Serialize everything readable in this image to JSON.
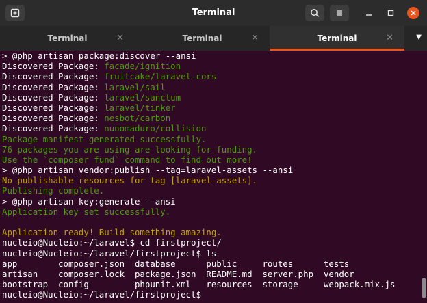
{
  "window": {
    "title": "Terminal"
  },
  "tabs": [
    {
      "label": "Terminal",
      "active": false
    },
    {
      "label": "Terminal",
      "active": false
    },
    {
      "label": "Terminal",
      "active": true
    }
  ],
  "icons": {
    "new_tab": "new-tab-icon",
    "search": "search-icon",
    "menu": "hamburger-icon",
    "minimize": "minimize-icon",
    "maximize": "maximize-icon",
    "close": "close-icon",
    "tab_close": "tab-close-icon",
    "tab_menu": "chevron-down-icon"
  },
  "colors": {
    "accent": "#e95420",
    "background": "#300a24",
    "green": "#4e9a06",
    "yellow": "#c4a000"
  },
  "lines": [
    [
      {
        "t": "> @php artisan package:discover --ansi",
        "c": "white"
      }
    ],
    [
      {
        "t": "Discovered Package: ",
        "c": "white"
      },
      {
        "t": "facade/ignition",
        "c": "green"
      }
    ],
    [
      {
        "t": "Discovered Package: ",
        "c": "white"
      },
      {
        "t": "fruitcake/laravel-cors",
        "c": "green"
      }
    ],
    [
      {
        "t": "Discovered Package: ",
        "c": "white"
      },
      {
        "t": "laravel/sail",
        "c": "green"
      }
    ],
    [
      {
        "t": "Discovered Package: ",
        "c": "white"
      },
      {
        "t": "laravel/sanctum",
        "c": "green"
      }
    ],
    [
      {
        "t": "Discovered Package: ",
        "c": "white"
      },
      {
        "t": "laravel/tinker",
        "c": "green"
      }
    ],
    [
      {
        "t": "Discovered Package: ",
        "c": "white"
      },
      {
        "t": "nesbot/carbon",
        "c": "green"
      }
    ],
    [
      {
        "t": "Discovered Package: ",
        "c": "white"
      },
      {
        "t": "nunomaduro/collision",
        "c": "green"
      }
    ],
    [
      {
        "t": "Package manifest generated successfully.",
        "c": "green"
      }
    ],
    [
      {
        "t": "76 packages you are using are looking for funding.",
        "c": "green"
      }
    ],
    [
      {
        "t": "Use the `composer fund` command to find out more!",
        "c": "green"
      }
    ],
    [
      {
        "t": "> @php artisan vendor:publish --tag=laravel-assets --ansi",
        "c": "white"
      }
    ],
    [
      {
        "t": "No publishable resources for tag [laravel-assets].",
        "c": "yellow"
      }
    ],
    [
      {
        "t": "Publishing complete.",
        "c": "green"
      }
    ],
    [
      {
        "t": "> @php artisan key:generate --ansi",
        "c": "white"
      }
    ],
    [
      {
        "t": "Application key set successfully.",
        "c": "green"
      }
    ],
    [
      {
        "t": "",
        "c": "white"
      }
    ],
    [
      {
        "t": "Application ready! Build something amazing.",
        "c": "yellow"
      }
    ],
    [
      {
        "t": "nucleio@Nucleio:~/laravel$ cd firstproject/",
        "c": "white"
      }
    ],
    [
      {
        "t": "nucleio@Nucleio:~/laravel/firstproject$ ls",
        "c": "white"
      }
    ],
    [
      {
        "t": "app        composer.json  database      public     routes      tests",
        "c": "white"
      }
    ],
    [
      {
        "t": "artisan    composer.lock  package.json  README.md  server.php  vendor",
        "c": "white"
      }
    ],
    [
      {
        "t": "bootstrap  config         phpunit.xml   resources  storage     webpack.mix.js",
        "c": "white"
      }
    ],
    [
      {
        "t": "nucleio@Nucleio:~/laravel/firstproject$ ",
        "c": "white"
      }
    ]
  ]
}
